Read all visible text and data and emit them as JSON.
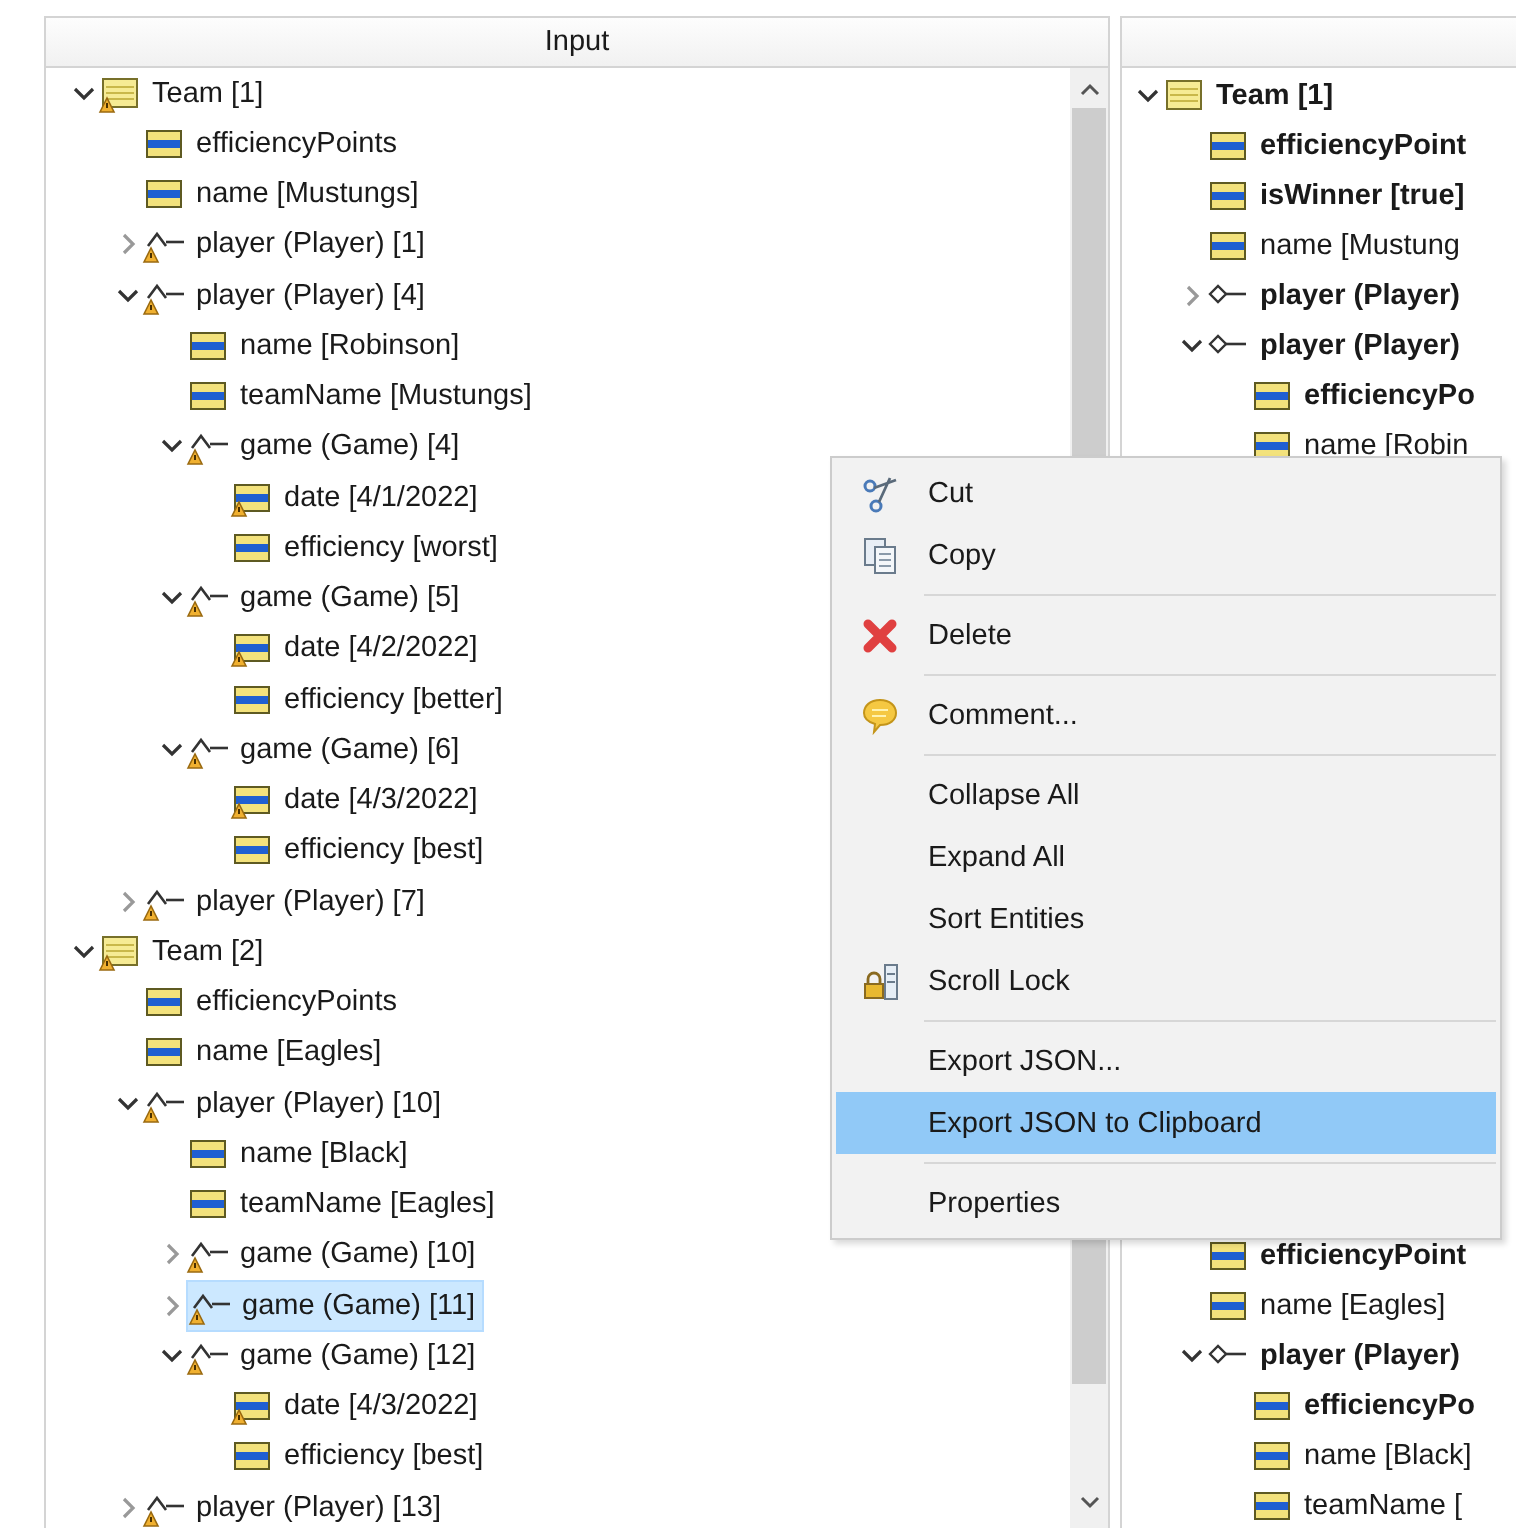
{
  "left_pane": {
    "header": "Input",
    "tree": [
      {
        "label": "Team [1]",
        "kind": "entity",
        "warning": true,
        "expanded": true,
        "selected": false,
        "children": [
          {
            "label": "efficiencyPoints",
            "kind": "attribute",
            "warning": false,
            "selected": false
          },
          {
            "label": "name [Mustungs]",
            "kind": "attribute",
            "warning": false,
            "selected": false
          },
          {
            "label": "player (Player) [1]",
            "kind": "reference",
            "warning": true,
            "expanded": false,
            "selected": false
          },
          {
            "label": "player (Player) [4]",
            "kind": "reference",
            "warning": true,
            "expanded": true,
            "selected": false,
            "children": [
              {
                "label": "name [Robinson]",
                "kind": "attribute",
                "warning": false,
                "selected": false
              },
              {
                "label": "teamName [Mustungs]",
                "kind": "attribute",
                "warning": false,
                "selected": false
              },
              {
                "label": "game (Game) [4]",
                "kind": "reference",
                "warning": true,
                "expanded": true,
                "selected": false,
                "children": [
                  {
                    "label": "date [4/1/2022]",
                    "kind": "attribute",
                    "warning": true,
                    "selected": false
                  },
                  {
                    "label": "efficiency [worst]",
                    "kind": "attribute",
                    "warning": false,
                    "selected": false
                  }
                ]
              },
              {
                "label": "game (Game) [5]",
                "kind": "reference",
                "warning": true,
                "expanded": true,
                "selected": false,
                "children": [
                  {
                    "label": "date [4/2/2022]",
                    "kind": "attribute",
                    "warning": true,
                    "selected": false
                  },
                  {
                    "label": "efficiency [better]",
                    "kind": "attribute",
                    "warning": false,
                    "selected": false
                  }
                ]
              },
              {
                "label": "game (Game) [6]",
                "kind": "reference",
                "warning": true,
                "expanded": true,
                "selected": false,
                "children": [
                  {
                    "label": "date [4/3/2022]",
                    "kind": "attribute",
                    "warning": true,
                    "selected": false
                  },
                  {
                    "label": "efficiency [best]",
                    "kind": "attribute",
                    "warning": false,
                    "selected": false
                  }
                ]
              }
            ]
          },
          {
            "label": "player (Player) [7]",
            "kind": "reference",
            "warning": true,
            "expanded": false,
            "selected": false
          }
        ]
      },
      {
        "label": "Team [2]",
        "kind": "entity",
        "warning": true,
        "expanded": true,
        "selected": false,
        "children": [
          {
            "label": "efficiencyPoints",
            "kind": "attribute",
            "warning": false,
            "selected": false
          },
          {
            "label": "name [Eagles]",
            "kind": "attribute",
            "warning": false,
            "selected": false
          },
          {
            "label": "player (Player) [10]",
            "kind": "reference",
            "warning": true,
            "expanded": true,
            "selected": false,
            "children": [
              {
                "label": "name [Black]",
                "kind": "attribute",
                "warning": false,
                "selected": false
              },
              {
                "label": "teamName [Eagles]",
                "kind": "attribute",
                "warning": false,
                "selected": false
              },
              {
                "label": "game (Game) [10]",
                "kind": "reference",
                "warning": true,
                "expanded": false,
                "selected": false
              },
              {
                "label": "game (Game) [11]",
                "kind": "reference",
                "warning": true,
                "expanded": false,
                "selected": true
              },
              {
                "label": "game (Game) [12]",
                "kind": "reference",
                "warning": true,
                "expanded": true,
                "selected": false,
                "children": [
                  {
                    "label": "date [4/3/2022]",
                    "kind": "attribute",
                    "warning": true,
                    "selected": false
                  },
                  {
                    "label": "efficiency [best]",
                    "kind": "attribute",
                    "warning": false,
                    "selected": false
                  }
                ]
              }
            ]
          },
          {
            "label": "player (Player) [13]",
            "kind": "reference",
            "warning": true,
            "expanded": false,
            "selected": false
          }
        ]
      }
    ]
  },
  "right_pane": {
    "upper_tree": [
      {
        "label": "Team [1]",
        "kind": "entity",
        "warning": false,
        "bold": true,
        "expanded": true,
        "selected": false,
        "children": [
          {
            "label": "efficiencyPoint",
            "kind": "attribute",
            "warning": false,
            "bold": true,
            "selected": false
          },
          {
            "label": "isWinner [true]",
            "kind": "attribute",
            "warning": false,
            "bold": true,
            "selected": false
          },
          {
            "label": "name [Mustung",
            "kind": "attribute",
            "warning": false,
            "bold": false,
            "selected": false
          },
          {
            "label": "player (Player)",
            "kind": "association",
            "warning": false,
            "bold": true,
            "expanded": false,
            "selected": false
          },
          {
            "label": "player (Player)",
            "kind": "association",
            "warning": false,
            "bold": true,
            "expanded": true,
            "selected": false,
            "children": [
              {
                "label": "efficiencyPo",
                "kind": "attribute",
                "warning": false,
                "bold": true,
                "selected": false
              },
              {
                "label": "name [Robin",
                "kind": "attribute",
                "warning": false,
                "bold": false,
                "selected": false
              }
            ]
          }
        ]
      }
    ],
    "lower_tree": [
      {
        "label": "efficiencyPoint",
        "kind": "attribute",
        "warning": false,
        "bold": true,
        "selected": false
      },
      {
        "label": "name [Eagles]",
        "kind": "attribute",
        "warning": false,
        "bold": false,
        "selected": false
      },
      {
        "label": "player (Player)",
        "kind": "association",
        "warning": false,
        "bold": true,
        "expanded": true,
        "selected": false,
        "children": [
          {
            "label": "efficiencyPo",
            "kind": "attribute",
            "warning": false,
            "bold": true,
            "selected": false
          },
          {
            "label": "name [Black]",
            "kind": "attribute",
            "warning": false,
            "bold": false,
            "selected": false
          },
          {
            "label": "teamName [",
            "kind": "attribute",
            "warning": false,
            "bold": false,
            "selected": false
          }
        ]
      }
    ]
  },
  "context_menu": {
    "groups": [
      [
        {
          "label": "Cut",
          "selected": false
        },
        {
          "label": "Copy",
          "selected": false
        }
      ],
      [
        {
          "label": "Delete",
          "selected": false
        }
      ],
      [
        {
          "label": "Comment...",
          "selected": false
        }
      ],
      [
        {
          "label": "Collapse All",
          "selected": false
        },
        {
          "label": "Expand All",
          "selected": false
        },
        {
          "label": "Sort Entities",
          "selected": false
        },
        {
          "label": "Scroll Lock",
          "selected": false
        }
      ],
      [
        {
          "label": "Export JSON...",
          "selected": false
        },
        {
          "label": "Export JSON to Clipboard",
          "selected": true
        }
      ],
      [
        {
          "label": "Properties",
          "selected": false
        }
      ]
    ]
  }
}
